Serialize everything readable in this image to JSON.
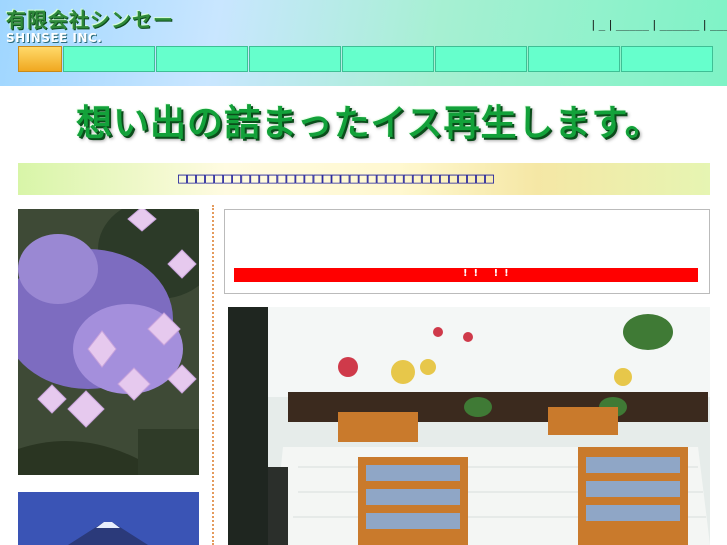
{
  "header": {
    "logo_jp": "有限会社シンセー",
    "logo_en": "SHINSEE INC.",
    "top_links": [
      "|",
      "_",
      "|",
      "_____",
      "|",
      "______",
      "|",
      "______"
    ]
  },
  "nav": {
    "home_color": "#f0a820",
    "item_color": "#66ffcc",
    "item_count": 7
  },
  "main": {
    "tagline": "想い出の詰まったイス再生します。",
    "banner_text": "□□□□□□□□□□□□□□□□□□□□□□□□□□□□□□□□□□□",
    "notice_text": "!!   !!"
  },
  "images": {
    "flower": "hydrangea-photo",
    "sky": "mount-fuji-photo",
    "room": "dining-room-photo"
  },
  "colors": {
    "accent_green": "#13a13a",
    "nav_mint": "#66ffcc",
    "notice_red": "#ff0000",
    "banner_text": "#1a1a99",
    "divider_orange": "#e49b5d"
  }
}
